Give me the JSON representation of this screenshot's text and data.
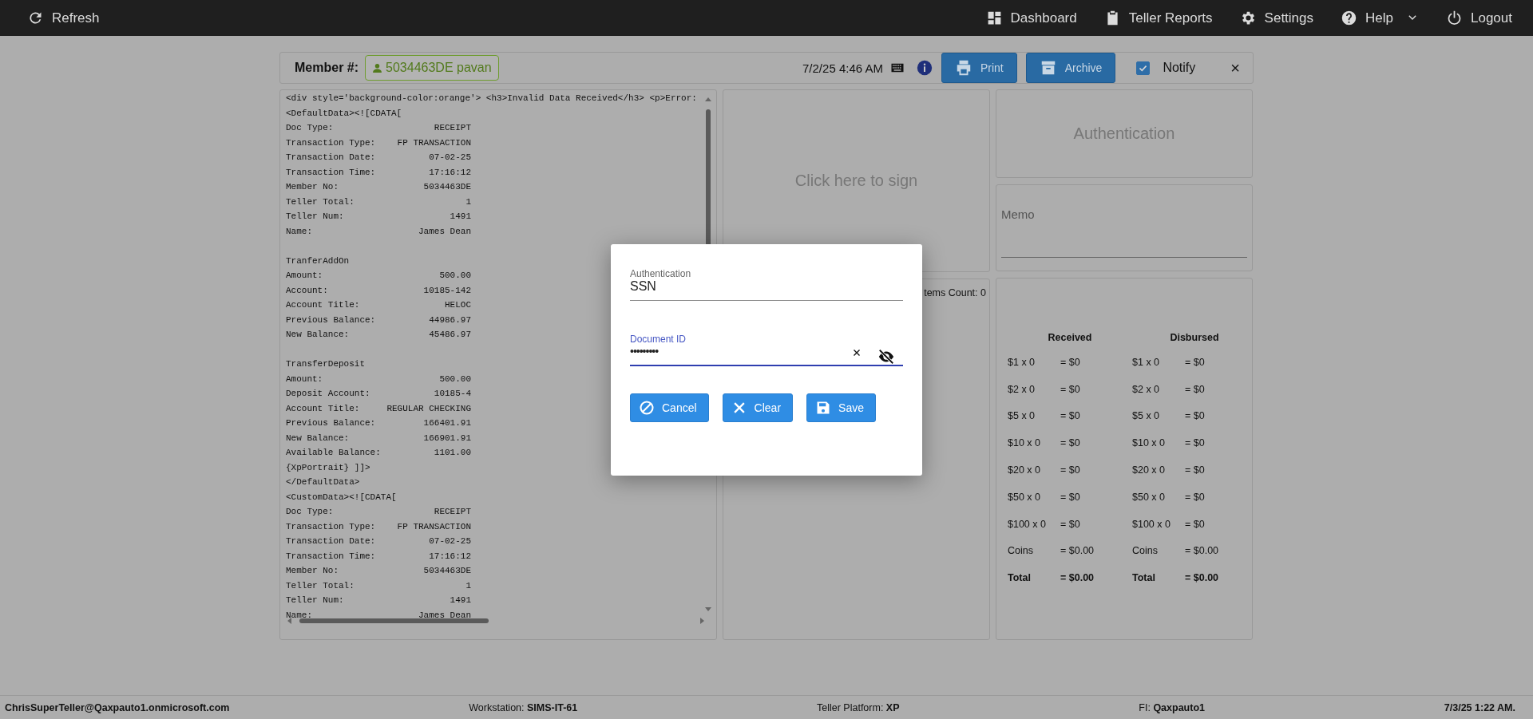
{
  "topbar": {
    "left": [
      {
        "label": "Refresh"
      }
    ],
    "right": [
      {
        "label": "Dashboard"
      },
      {
        "label": "Teller Reports"
      },
      {
        "label": "Settings"
      },
      {
        "label": "Help",
        "dropdown": true
      },
      {
        "label": "Logout"
      }
    ]
  },
  "header": {
    "member_label": "Member #:",
    "member": "5034463DE pavan",
    "datetime": "7/2/25 4:46 AM",
    "buttons": [
      {
        "label": "Print"
      },
      {
        "label": "Archive"
      }
    ],
    "notify": {
      "label": "Notify",
      "checked": true
    },
    "close": "×"
  },
  "receipt": {
    "lines": [
      {
        "kind": "text",
        "text": "<div style='background-color:orange'> <h3>Invalid Data Received</h3> <p>Error:"
      },
      {
        "kind": "text",
        "text": "<DefaultData><![CDATA["
      },
      {
        "kind": "field",
        "label": "Doc Type:",
        "value": "RECEIPT"
      },
      {
        "kind": "field",
        "label": "Transaction Type:",
        "value": "FP TRANSACTION"
      },
      {
        "kind": "field",
        "label": "Transaction Date:",
        "value": "07-02-25"
      },
      {
        "kind": "field",
        "label": "Transaction Time:",
        "value": "17:16:12"
      },
      {
        "kind": "field",
        "label": "Member No:",
        "value": "5034463DE"
      },
      {
        "kind": "field",
        "label": "Teller Total:",
        "value": "1"
      },
      {
        "kind": "field",
        "label": "Teller Num:",
        "value": "1491"
      },
      {
        "kind": "field",
        "label": "Name:",
        "value": "James Dean"
      },
      {
        "kind": "blank"
      },
      {
        "kind": "text",
        "text": "TranferAddOn"
      },
      {
        "kind": "field",
        "label": "Amount:",
        "value": "500.00"
      },
      {
        "kind": "field",
        "label": "Account:",
        "value": "10185-142"
      },
      {
        "kind": "field",
        "label": "Account Title:",
        "value": "HELOC"
      },
      {
        "kind": "field",
        "label": "Previous Balance:",
        "value": "44986.97"
      },
      {
        "kind": "field",
        "label": "New Balance:",
        "value": "45486.97"
      },
      {
        "kind": "blank"
      },
      {
        "kind": "text",
        "text": "TransferDeposit"
      },
      {
        "kind": "field",
        "label": "Amount:",
        "value": "500.00"
      },
      {
        "kind": "field",
        "label": "Deposit Account:",
        "value": "10185-4"
      },
      {
        "kind": "field",
        "label": "Account Title:",
        "value": "REGULAR CHECKING"
      },
      {
        "kind": "field",
        "label": "Previous Balance:",
        "value": "166401.91"
      },
      {
        "kind": "field",
        "label": "New Balance:",
        "value": "166901.91"
      },
      {
        "kind": "field",
        "label": "Available Balance:",
        "value": "1101.00"
      },
      {
        "kind": "text",
        "text": "{XpPortrait} ]]>"
      },
      {
        "kind": "text",
        "text": "</DefaultData>"
      },
      {
        "kind": "text",
        "text": "<CustomData><![CDATA["
      },
      {
        "kind": "field",
        "label": "Doc Type:",
        "value": "RECEIPT"
      },
      {
        "kind": "field",
        "label": "Transaction Type:",
        "value": "FP TRANSACTION"
      },
      {
        "kind": "field",
        "label": "Transaction Date:",
        "value": "07-02-25"
      },
      {
        "kind": "field",
        "label": "Transaction Time:",
        "value": "17:16:12"
      },
      {
        "kind": "field",
        "label": "Member No:",
        "value": "5034463DE"
      },
      {
        "kind": "field",
        "label": "Teller Total:",
        "value": "1"
      },
      {
        "kind": "field",
        "label": "Teller Num:",
        "value": "1491"
      },
      {
        "kind": "field",
        "label": "Name:",
        "value": "James Dean"
      }
    ]
  },
  "signature": {
    "prompt": "Click here to sign"
  },
  "scanned": {
    "count": "tems Count: 0"
  },
  "authentication": {
    "title": "Authentication"
  },
  "memo": {
    "label": "Memo"
  },
  "cash": {
    "headers": [
      "Received",
      "Disbursed"
    ],
    "rows": [
      {
        "kind": "line",
        "received": [
          "$1 x 0",
          "= $0"
        ],
        "disbursed": [
          "$1 x 0",
          "= $0"
        ]
      },
      {
        "kind": "line",
        "received": [
          "$2 x 0",
          "= $0"
        ],
        "disbursed": [
          "$2 x 0",
          "= $0"
        ]
      },
      {
        "kind": "line",
        "received": [
          "$5 x 0",
          "= $0"
        ],
        "disbursed": [
          "$5 x 0",
          "= $0"
        ]
      },
      {
        "kind": "line",
        "received": [
          "$10 x 0",
          "= $0"
        ],
        "disbursed": [
          "$10 x 0",
          "= $0"
        ]
      },
      {
        "kind": "line",
        "received": [
          "$20 x 0",
          "= $0"
        ],
        "disbursed": [
          "$20 x 0",
          "= $0"
        ]
      },
      {
        "kind": "line",
        "received": [
          "$50 x 0",
          "= $0"
        ],
        "disbursed": [
          "$50 x 0",
          "= $0"
        ]
      },
      {
        "kind": "line",
        "received": [
          "$100 x 0",
          "= $0"
        ],
        "disbursed": [
          "$100 x 0",
          "= $0"
        ]
      },
      {
        "kind": "line",
        "received": [
          "Coins",
          "= $0.00"
        ],
        "disbursed": [
          "Coins",
          "= $0.00"
        ]
      },
      {
        "kind": "total",
        "received": [
          "Total",
          "= $0.00"
        ],
        "disbursed": [
          "Total",
          "= $0.00"
        ]
      }
    ]
  },
  "dialog": {
    "fields": [
      {
        "label": "Authentication",
        "value": "SSN",
        "focused": false,
        "secret": false
      },
      {
        "label": "Document ID",
        "value": "•••••••••",
        "focused": true,
        "secret": true
      }
    ],
    "buttons": [
      {
        "label": "Cancel"
      },
      {
        "label": "Clear"
      },
      {
        "label": "Save"
      }
    ]
  },
  "status_bar": [
    "**ChrisSuperTeller@Qaxpauto1.onmicrosoft.com**",
    "Workstation: **SIMS-IT-61**",
    "Teller Platform: **XP**",
    "FI: **Qaxpauto1**",
    "**7/3/25 1:22 AM.**"
  ]
}
